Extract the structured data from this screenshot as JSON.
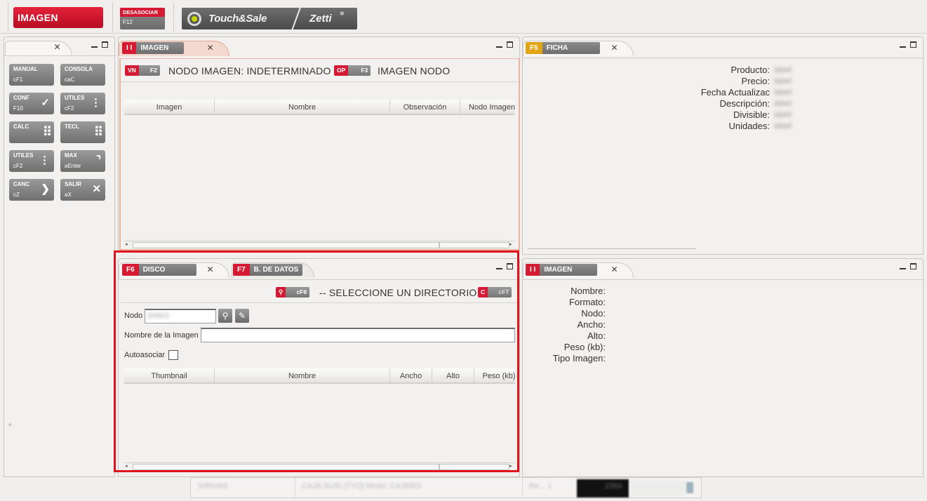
{
  "toolbar": {
    "imagen_label": "IMAGEN",
    "desasociar_label": "DESASOCIAR",
    "desasociar_key": "F12",
    "logo_brand": "Touch&Sale",
    "logo_partner": "Zetti"
  },
  "keypad": [
    {
      "label": "MANUAL",
      "shortcut": "cF1",
      "icon": ""
    },
    {
      "label": "CONSOLA",
      "shortcut": "caC",
      "icon": ""
    },
    {
      "label": "CONF",
      "shortcut": "F10",
      "icon": "check-icon"
    },
    {
      "label": "UTILES",
      "shortcut": "cF2",
      "icon": "dots-vertical-icon"
    },
    {
      "label": "CALC",
      "shortcut": "",
      "icon": "calculator-grid-icon"
    },
    {
      "label": "TECL",
      "shortcut": "",
      "icon": "keyboard-icon"
    },
    {
      "label": "UTILES",
      "shortcut": "cF2",
      "icon": "dots-vertical-icon"
    },
    {
      "label": "MAX",
      "shortcut": "aEnter",
      "icon": "maximize-icon"
    },
    {
      "label": "CANC",
      "shortcut": "cZ",
      "icon": "chevron-right-icon"
    },
    {
      "label": "SALIR",
      "shortcut": "aX",
      "icon": "close-icon"
    }
  ],
  "imagen_panel": {
    "tab_key": "I I",
    "tab_label": "IMAGEN",
    "vn_key": "VN",
    "vn_shortcut": "F2",
    "nodo_title": "NODO IMAGEN: INDETERMINADO",
    "op_key": "OP",
    "op_shortcut": "F3",
    "imagen_nodo": "IMAGEN NODO",
    "columns": [
      "Imagen",
      "Nombre",
      "Observación",
      "Nodo Imagen"
    ]
  },
  "ficha_panel": {
    "tab_key": "F5",
    "tab_label": "FICHA",
    "fields": [
      {
        "label": "Producto:",
        "value": "label"
      },
      {
        "label": "Precio:",
        "value": "label"
      },
      {
        "label": "Fecha Actualizac",
        "value": "label"
      },
      {
        "label": "Descripción:",
        "value": "label"
      },
      {
        "label": "Divisible:",
        "value": "label"
      },
      {
        "label": "Unidades:",
        "value": "label"
      }
    ]
  },
  "disco_panel": {
    "tab_key": "F6",
    "tab_label": "DISCO",
    "tab2_key": "F7",
    "tab2_label": "B. DE DATOS",
    "search_shortcut": "cF6",
    "directory_text": "-- SELECCIONE UN DIRECTORIO --",
    "clear_key": "C",
    "clear_shortcut": "cF7",
    "nodo_label": "Nodo",
    "nodo_value": "DISKO",
    "nombre_label": "Nombre de la Imagen",
    "nombre_value": "",
    "autoasociar_label": "Autoasociar",
    "columns": [
      "Thumbnail",
      "Nombre",
      "Ancho",
      "Alto",
      "Peso (kb)"
    ]
  },
  "imagen_info_panel": {
    "tab_key": "I I",
    "tab_label": "IMAGEN",
    "fields": [
      "Nombre:",
      "Formato:",
      "Nodo:",
      "Ancho:",
      "Alto:",
      "Peso (kb):",
      "Tipo Imagen:"
    ]
  },
  "statusbar": {
    "cell1": "SIRIVAS",
    "cell2": "CAJA SUSI (TYO) Modo: CAJERO",
    "cell3": "Re... 1",
    "cell4": "2384",
    "cell5": ""
  }
}
